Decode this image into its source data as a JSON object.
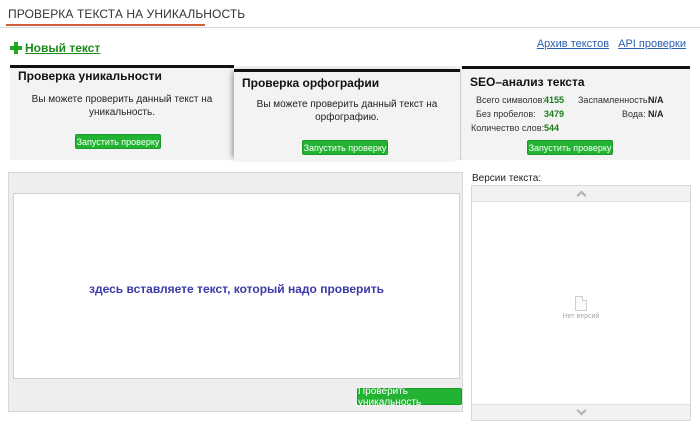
{
  "header": {
    "title": "ПРОВЕРКА ТЕКСТА НА УНИКАЛЬНОСТЬ"
  },
  "actions": {
    "new_text": "Новый текст",
    "archive_link": "Архив текстов",
    "api_link": "API проверки"
  },
  "panels": {
    "uniqueness": {
      "title": "Проверка уникальности",
      "description": "Вы можете проверить данный текст на уникальность.",
      "button": "Запустить проверку"
    },
    "spelling": {
      "title": "Проверка орфографии",
      "description": "Вы можете проверить данный текст на орфографию.",
      "button": "Запустить проверку"
    },
    "seo": {
      "title": "SEO–анализ текста",
      "stats": {
        "total_chars_label": "Всего символов:",
        "total_chars_value": "4155",
        "no_spaces_label": "Без пробелов:",
        "no_spaces_value": "3479",
        "word_count_label": "Количество слов:",
        "word_count_value": "544",
        "spam_label": "Заспамленность:",
        "spam_value": "N/A",
        "water_label": "Вода:",
        "water_value": "N/A"
      },
      "button": "Запустить проверку"
    }
  },
  "editor": {
    "placeholder": "здесь вставляете текст, который надо проверить",
    "check_button": "Проверить уникальность"
  },
  "versions": {
    "label": "Версии текста:",
    "empty": "Нет версий"
  },
  "colors": {
    "accent_underline": "#d35f3a",
    "button_green": "#22b332",
    "link_blue": "#2a5fb0",
    "value_green": "#1b7d1b",
    "placeholder_blue": "#3a3aa8"
  }
}
